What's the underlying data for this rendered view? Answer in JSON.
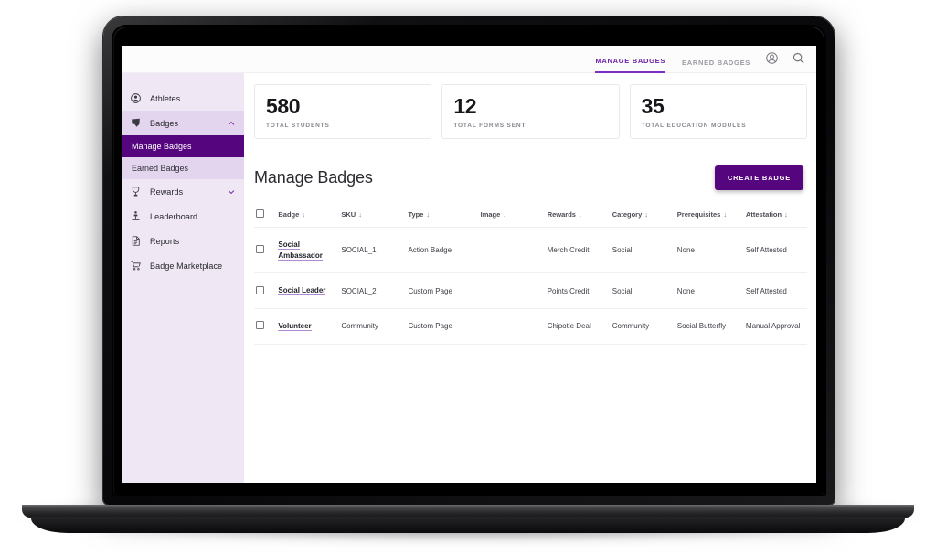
{
  "header": {
    "tabs": [
      {
        "label": "MANAGE BADGES",
        "active": true
      },
      {
        "label": "EARNED BADGES",
        "active": false
      }
    ],
    "account_icon": "account-circle-icon",
    "search_icon": "search-icon"
  },
  "sidebar": {
    "items": [
      {
        "label": "Athletes",
        "icon": "person-icon",
        "expandable": false
      },
      {
        "label": "Badges",
        "icon": "badge-icon",
        "expandable": true,
        "expanded": true,
        "chevron": "chevron-up-icon"
      },
      {
        "label": "Rewards",
        "icon": "trophy-icon",
        "expandable": true,
        "expanded": false,
        "chevron": "chevron-down-icon"
      },
      {
        "label": "Leaderboard",
        "icon": "podium-icon",
        "expandable": false
      },
      {
        "label": "Reports",
        "icon": "document-icon",
        "expandable": false
      },
      {
        "label": "Badge Marketplace",
        "icon": "shopping-cart-icon",
        "expandable": false
      }
    ],
    "badges_subitems": [
      {
        "label": "Manage Badges",
        "active": true
      },
      {
        "label": "Earned Badges",
        "active": false
      }
    ]
  },
  "stats": [
    {
      "value": "580",
      "label": "TOTAL STUDENTS"
    },
    {
      "value": "12",
      "label": "TOTAL FORMS SENT"
    },
    {
      "value": "35",
      "label": "TOTAL EDUCATION MODULES"
    }
  ],
  "main": {
    "title": "Manage Badges",
    "create_button": "CREATE BADGE"
  },
  "table": {
    "columns": [
      {
        "key": "badge",
        "label": "Badge",
        "sortable": true
      },
      {
        "key": "sku",
        "label": "SKU",
        "sortable": true
      },
      {
        "key": "type",
        "label": "Type",
        "sortable": true
      },
      {
        "key": "image",
        "label": "Image",
        "sortable": true
      },
      {
        "key": "rewards",
        "label": "Rewards",
        "sortable": true
      },
      {
        "key": "category",
        "label": "Category",
        "sortable": true
      },
      {
        "key": "prerequisites",
        "label": "Prerequisites",
        "sortable": true
      },
      {
        "key": "attestation",
        "label": "Attestation",
        "sortable": true
      }
    ],
    "sort_glyph": "↓",
    "rows": [
      {
        "selected": false,
        "badge": "Social Ambassador",
        "sku": "SOCIAL_1",
        "type": "Action Badge",
        "image": "",
        "rewards": "Merch Credit",
        "category": "Social",
        "prerequisites": "None",
        "attestation": "Self Attested"
      },
      {
        "selected": false,
        "badge": "Social Leader",
        "sku": "SOCIAL_2",
        "type": "Custom Page",
        "image": "",
        "rewards": "Points Credit",
        "category": "Social",
        "prerequisites": "None",
        "attestation": "Self Attested"
      },
      {
        "selected": false,
        "badge": "Volunteer",
        "sku": "Community",
        "type": "Custom Page",
        "image": "",
        "rewards": "Chipotle Deal",
        "category": "Community",
        "prerequisites": "Social Butterfly",
        "attestation": "Manual Approval"
      }
    ]
  },
  "colors": {
    "brand_purple": "#55067e",
    "accent_purple": "#7b2fbf",
    "sidebar_bg": "#efe7f3",
    "sidebar_expanded": "#e4d5ee",
    "text_dark": "#22222a"
  }
}
